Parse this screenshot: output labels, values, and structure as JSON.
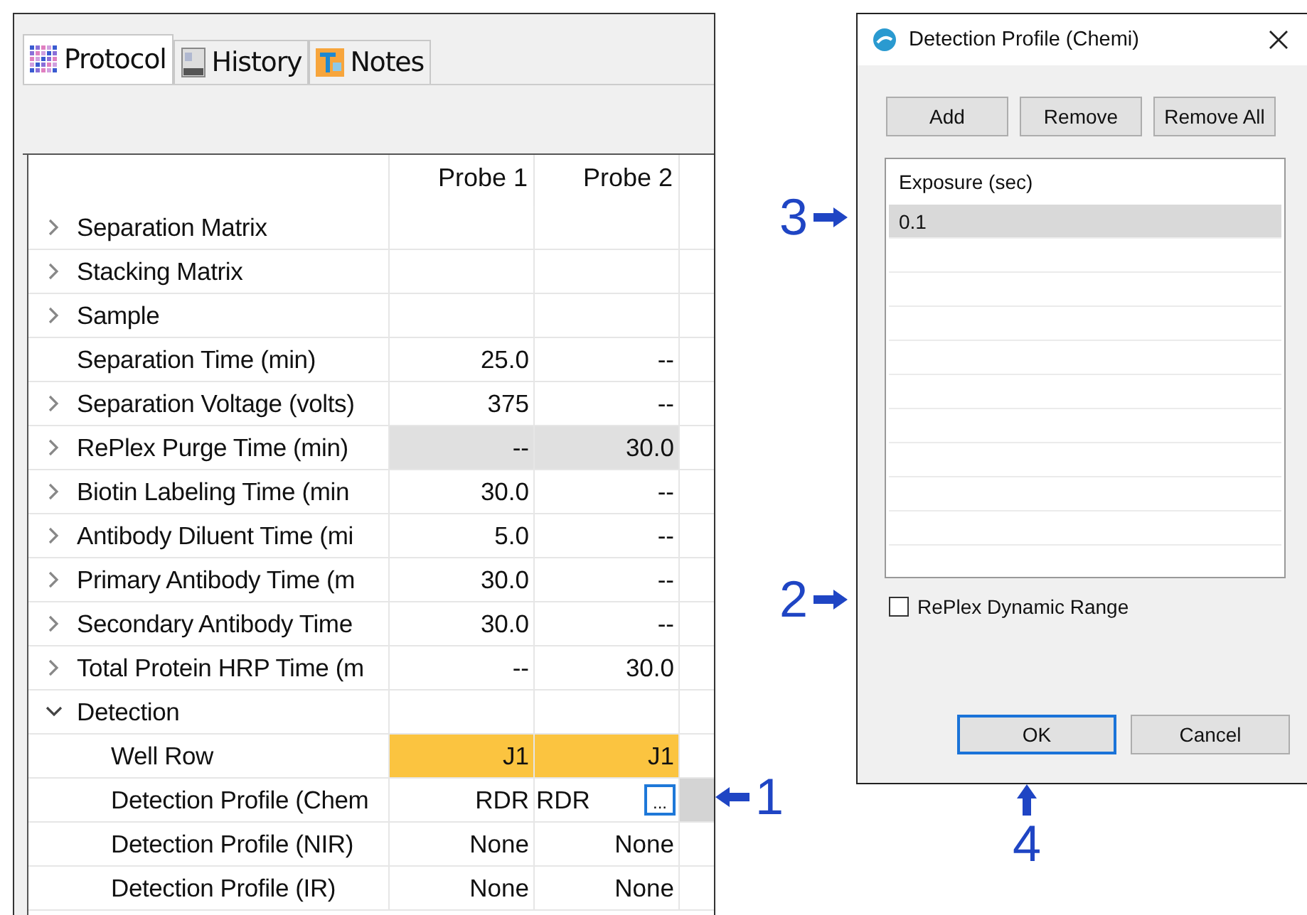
{
  "protocol_window": {
    "tabs": [
      {
        "label": "Protocol",
        "selected": true
      },
      {
        "label": "History",
        "selected": false
      },
      {
        "label": "Notes",
        "selected": false
      }
    ],
    "table": {
      "columns": [
        "Probe 1",
        "Probe 2"
      ],
      "rows": [
        {
          "label": "Separation Matrix",
          "expanded": false,
          "selected": false,
          "flagged": false
        },
        {
          "label": "Stacking Matrix",
          "expanded": false,
          "selected": false,
          "flagged": false
        },
        {
          "label": "Sample",
          "expanded": false,
          "selected": false,
          "flagged": false
        },
        {
          "label": "Separation Time (min)",
          "values": [
            "25.0",
            "--"
          ],
          "selected": false,
          "flagged": false
        },
        {
          "label": "Separation Voltage (volts)",
          "expanded": false,
          "values": [
            "375",
            "--"
          ],
          "selected": false,
          "flagged": false
        },
        {
          "label": "RePlex Purge Time (min)",
          "expanded": false,
          "values": [
            "--",
            "30.0"
          ],
          "selected": true,
          "flagged": false
        },
        {
          "label": "Biotin Labeling Time (min",
          "expanded": false,
          "values": [
            "30.0",
            "--"
          ],
          "selected": false,
          "flagged": false
        },
        {
          "label": "Antibody Diluent Time (mi",
          "expanded": false,
          "values": [
            "5.0",
            "--"
          ],
          "selected": false,
          "flagged": false
        },
        {
          "label": "Primary Antibody Time (m",
          "expanded": false,
          "values": [
            "30.0",
            "--"
          ],
          "selected": false,
          "flagged": false
        },
        {
          "label": "Secondary Antibody Time",
          "expanded": false,
          "values": [
            "30.0",
            "--"
          ],
          "selected": false,
          "flagged": false
        },
        {
          "label": "Total Protein HRP Time (m",
          "expanded": false,
          "values": [
            "--",
            "30.0"
          ],
          "selected": false,
          "flagged": false
        },
        {
          "label": "Detection",
          "expanded": true,
          "selected": false,
          "flagged": false,
          "children": [
            {
              "label": "Well Row",
              "values": [
                "J1",
                "J1"
              ],
              "selected": false,
              "flagged": true
            },
            {
              "label": "Detection Profile (Chem",
              "values": [
                "RDR"
              ],
              "editor": {
                "value": "RDR",
                "button": "..."
              },
              "selected": false,
              "flagged": false
            },
            {
              "label": "Detection Profile (NIR)",
              "values": [
                "None",
                "None"
              ],
              "selected": false,
              "flagged": false
            },
            {
              "label": "Detection Profile (IR)",
              "values": [
                "None",
                "None"
              ],
              "selected": false,
              "flagged": false
            }
          ]
        }
      ]
    }
  },
  "dialog": {
    "title": "Detection Profile (Chemi)",
    "toolbar": [
      "Add",
      "Remove",
      "Remove All"
    ],
    "list": {
      "header": "Exposure (sec)",
      "rows": [
        {
          "text": "0.1",
          "selected": true
        }
      ]
    },
    "checkbox": {
      "label": "RePlex Dynamic Range",
      "checked": false
    },
    "buttons": [
      {
        "label": "OK",
        "focused": true
      },
      {
        "label": "Cancel",
        "focused": false
      }
    ]
  },
  "callouts": [
    {
      "number": "3"
    },
    {
      "number": "2"
    },
    {
      "number": "1"
    },
    {
      "number": "4"
    }
  ]
}
